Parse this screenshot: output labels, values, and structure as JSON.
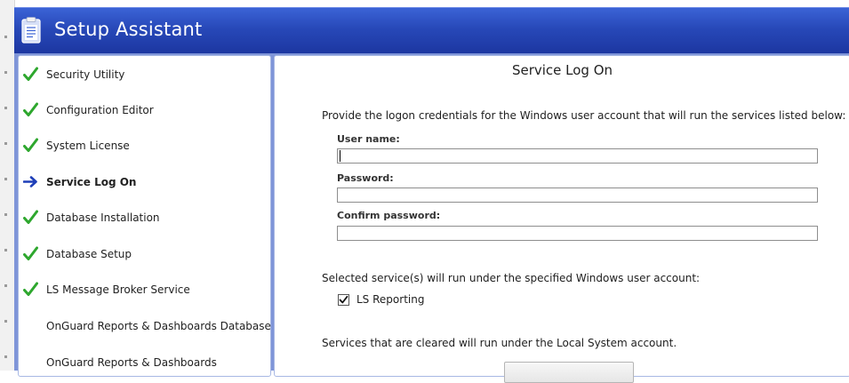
{
  "window": {
    "title": "Setup Assistant",
    "title_icon": "clipboard-icon",
    "accent_color": "#2748b8"
  },
  "sidebar": {
    "items": [
      {
        "label": "Security Utility",
        "status": "complete",
        "icon": "checkmark-icon"
      },
      {
        "label": "Configuration Editor",
        "status": "complete",
        "icon": "checkmark-icon"
      },
      {
        "label": "System License",
        "status": "complete",
        "icon": "checkmark-icon"
      },
      {
        "label": "Service Log On",
        "status": "current",
        "icon": "arrow-right-icon"
      },
      {
        "label": "Database Installation",
        "status": "complete",
        "icon": "checkmark-icon"
      },
      {
        "label": "Database Setup",
        "status": "complete",
        "icon": "checkmark-icon"
      },
      {
        "label": "LS Message Broker Service",
        "status": "complete",
        "icon": "checkmark-icon"
      },
      {
        "label": "OnGuard Reports & Dashboards Database",
        "status": "pending",
        "icon": ""
      },
      {
        "label": "OnGuard Reports & Dashboards",
        "status": "pending",
        "icon": ""
      }
    ],
    "check_color": "#2ea72e",
    "arrow_color": "#1f3fb8"
  },
  "main": {
    "title": "Service Log On",
    "intro": "Provide the logon credentials for the Windows user account that will run the services listed below:",
    "fields": {
      "username": {
        "label": "User name:",
        "value": ""
      },
      "password": {
        "label": "Password:",
        "value": ""
      },
      "confirm": {
        "label": "Confirm password:",
        "value": ""
      }
    },
    "services_text": "Selected service(s) will run under the specified Windows user account:",
    "services": [
      {
        "label": "LS Reporting",
        "checked": true
      }
    ],
    "cleared_text": "Services that are cleared will run under the Local System account."
  }
}
